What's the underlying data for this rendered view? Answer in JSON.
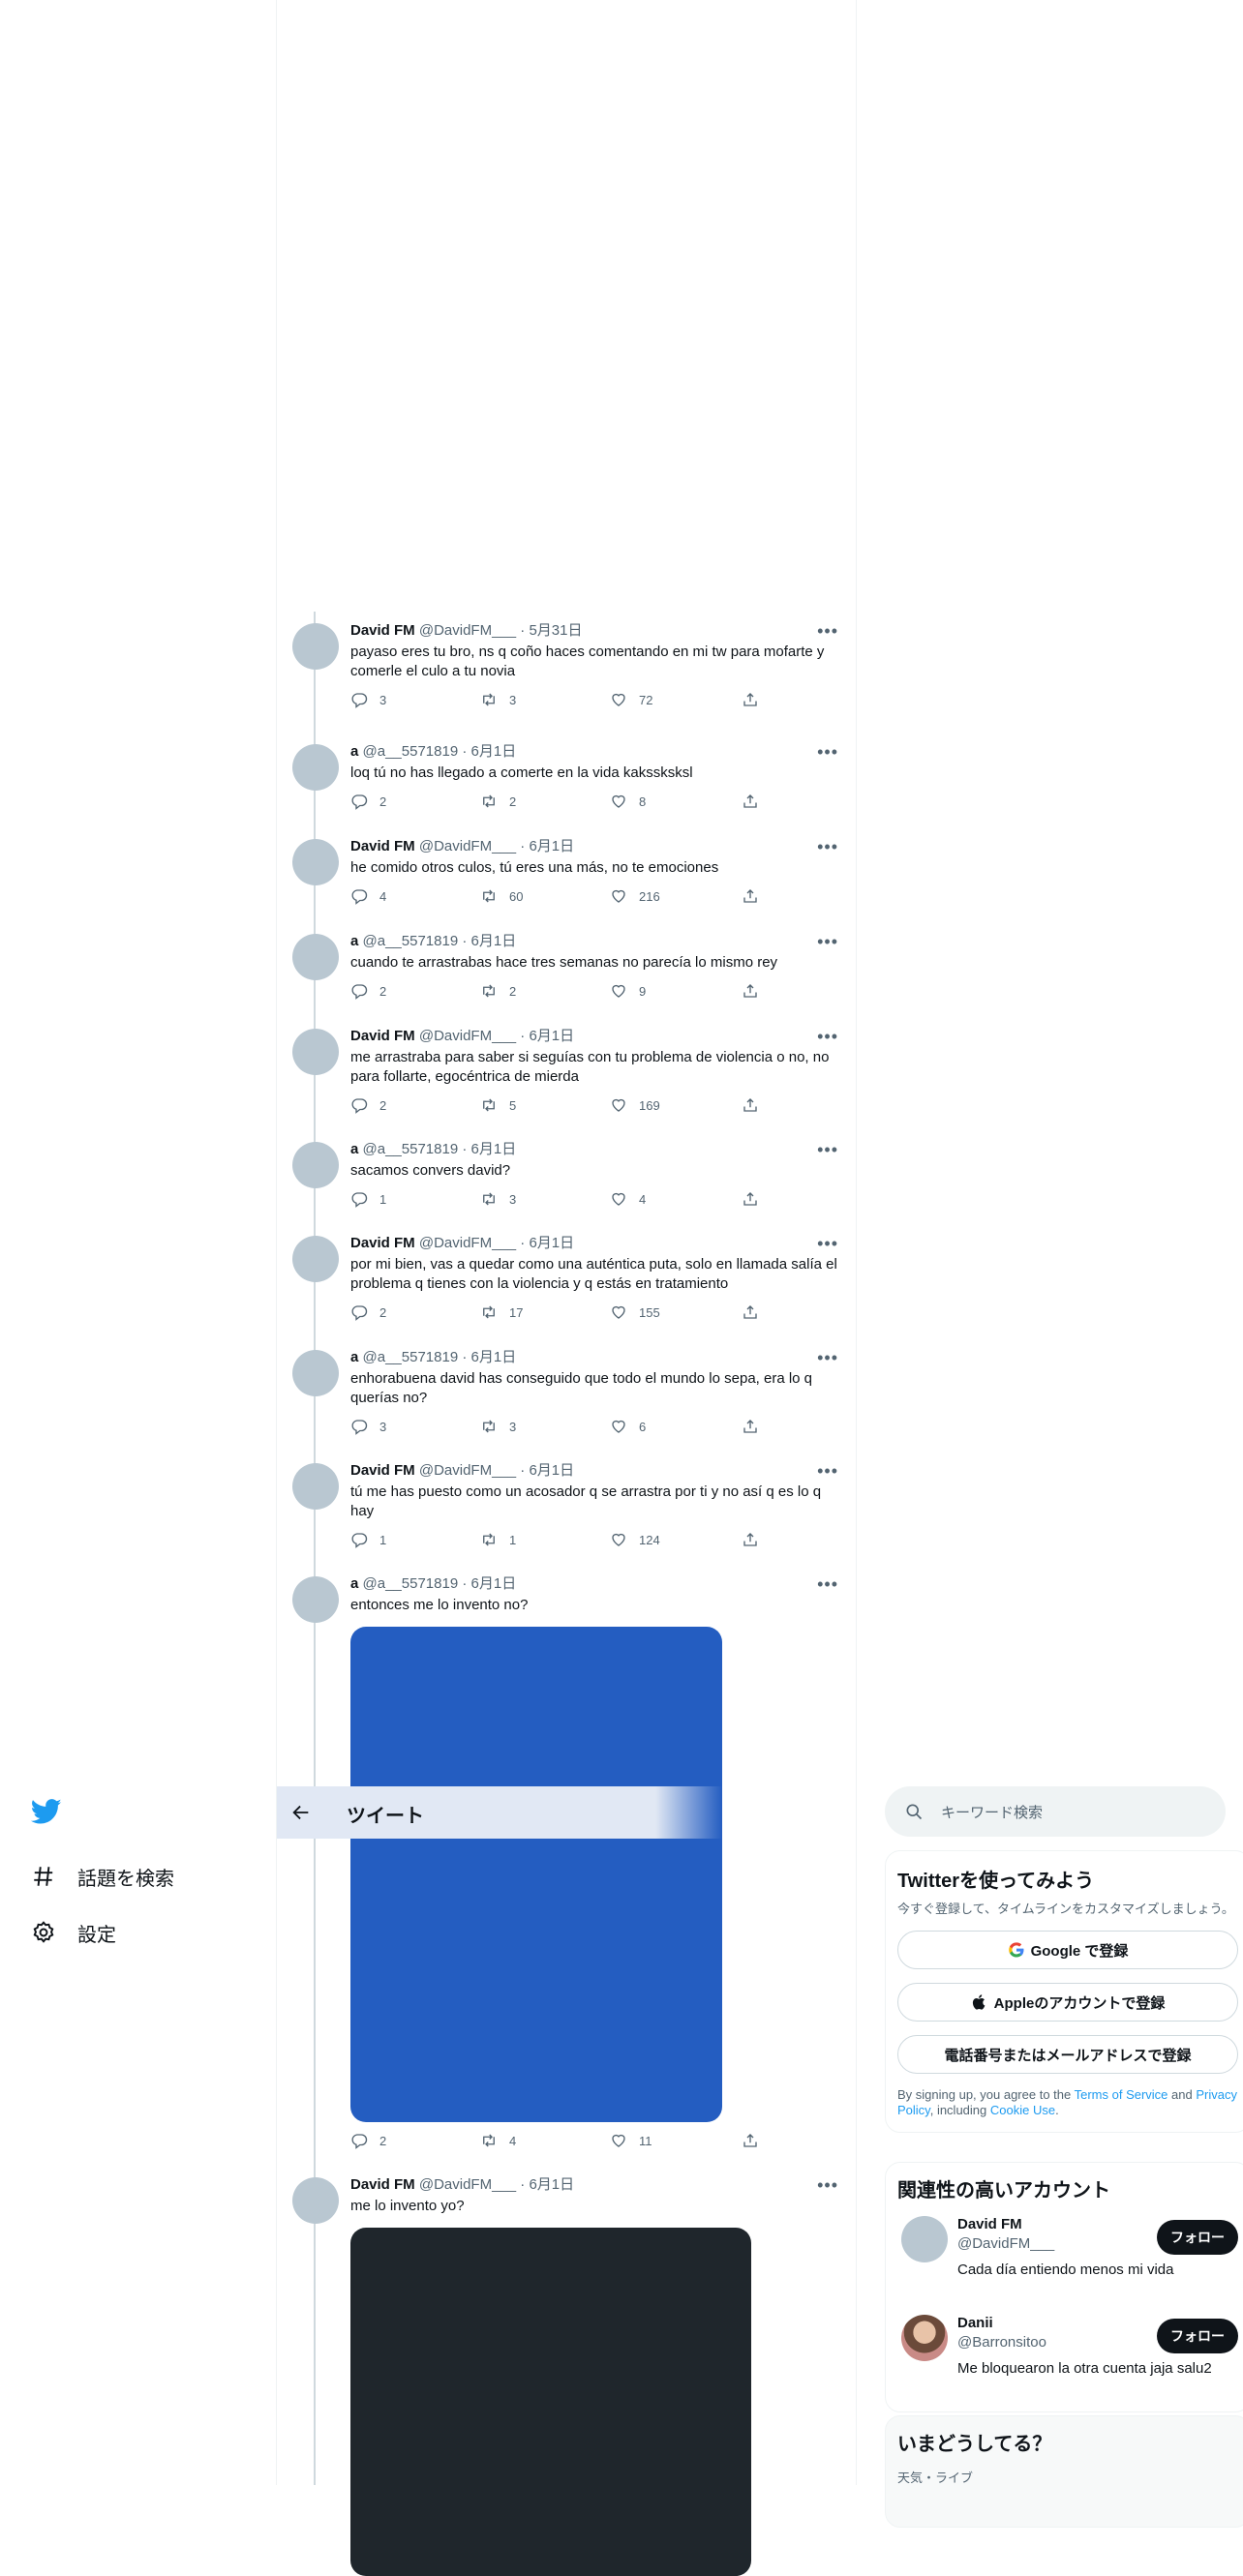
{
  "nav": {
    "items": [
      {
        "label": "話題を検索",
        "icon": "hashtag-icon"
      },
      {
        "label": "設定",
        "icon": "gear-icon"
      }
    ]
  },
  "header": {
    "title": "ツイート"
  },
  "tweets": [
    {
      "name": "David FM",
      "handle": "@DavidFM___",
      "date": "· 5月31日",
      "text": "payaso eres tu bro, ns q coño haces comentando en mi tw para mofarte y comerle el culo a tu novia",
      "replies": "3",
      "retweets": "3",
      "likes": "72"
    },
    {
      "name": "a",
      "handle": "@a__5571819",
      "date": "· 6月1日",
      "text": "loq tú no has llegado a comerte en la vida kakssksksl",
      "replies": "2",
      "retweets": "2",
      "likes": "8"
    },
    {
      "name": "David FM",
      "handle": "@DavidFM___",
      "date": "· 6月1日",
      "text": "he comido otros culos, tú eres una más, no te emociones",
      "replies": "4",
      "retweets": "60",
      "likes": "216"
    },
    {
      "name": "a",
      "handle": "@a__5571819",
      "date": "· 6月1日",
      "text": "cuando te arrastrabas hace tres semanas no parecía lo mismo rey",
      "replies": "2",
      "retweets": "2",
      "likes": "9"
    },
    {
      "name": "David FM",
      "handle": "@DavidFM___",
      "date": "· 6月1日",
      "text": "me arrastraba para saber si seguías con tu problema de violencia o no, no para follarte, egocéntrica de mierda",
      "replies": "2",
      "retweets": "5",
      "likes": "169"
    },
    {
      "name": "a",
      "handle": "@a__5571819",
      "date": "· 6月1日",
      "text": "sacamos convers david?",
      "replies": "1",
      "retweets": "3",
      "likes": "4"
    },
    {
      "name": "David FM",
      "handle": "@DavidFM___",
      "date": "· 6月1日",
      "text": "por mi bien, vas a quedar como una auténtica puta, solo en llamada salía el problema q tienes con la violencia y q estás en tratamiento",
      "replies": "2",
      "retweets": "17",
      "likes": "155"
    },
    {
      "name": "a",
      "handle": "@a__5571819",
      "date": "· 6月1日",
      "text": "enhorabuena david has conseguido que todo el mundo lo sepa, era lo q querías no?",
      "replies": "3",
      "retweets": "3",
      "likes": "6"
    },
    {
      "name": "David FM",
      "handle": "@DavidFM___",
      "date": "· 6月1日",
      "text": "tú me has puesto como un acosador q se arrastra por ti y no así q es lo q hay",
      "replies": "1",
      "retweets": "1",
      "likes": "124"
    },
    {
      "name": "a",
      "handle": "@a__5571819",
      "date": "· 6月1日",
      "text": "entonces me lo invento no?",
      "replies": "2",
      "retweets": "4",
      "likes": "11",
      "media_color": "#245dc1"
    },
    {
      "name": "David FM",
      "handle": "@DavidFM___",
      "date": "· 6月1日",
      "text": "me lo invento yo?",
      "media_color": "#1f262c"
    }
  ],
  "search": {
    "placeholder": "キーワード検索"
  },
  "signup": {
    "title": "Twitterを使ってみよう",
    "subtitle": "今すぐ登録して、タイムラインをカスタマイズしましょう。",
    "google_label": "Google で登録",
    "apple_label": "Appleのアカウントで登録",
    "phone_label": "電話番号またはメールアドレスで登録",
    "legal_1": "By signing up, you agree to the ",
    "terms": "Terms of Service",
    "legal_2": " and ",
    "privacy": "Privacy Policy",
    "legal_3": ", including ",
    "cookie": "Cookie Use",
    "legal_4": "."
  },
  "related": {
    "title": "関連性の高いアカウント",
    "accounts": [
      {
        "name": "David FM",
        "handle": "@DavidFM___",
        "bio": "Cada día entiendo menos mi vida",
        "follow_label": "フォロー"
      },
      {
        "name": "Danii",
        "handle": "@Barronsitoo",
        "bio": "Me bloquearon la otra cuenta jaja salu2",
        "follow_label": "フォロー"
      }
    ]
  },
  "trends": {
    "title": "いまどうしてる？",
    "category": "天気・ライブ"
  },
  "colors": {
    "accent": "#1d9bf0",
    "text": "#0f1419",
    "muted": "#536471"
  }
}
